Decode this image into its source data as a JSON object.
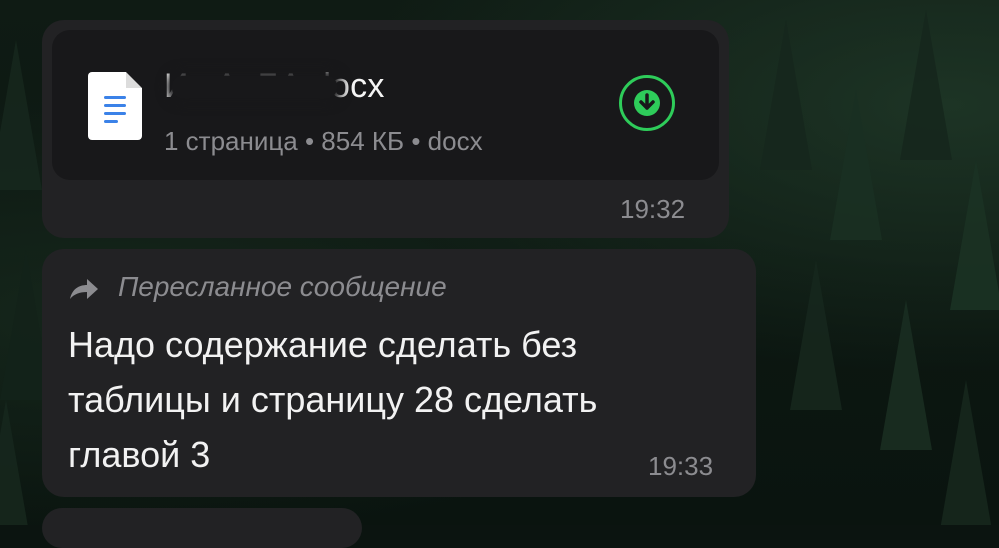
{
  "messages": [
    {
      "type": "file",
      "file_icon": "document-icon",
      "file_name": "Ис                А.  БА.docx",
      "meta": "1 страница • 854 КБ • docx",
      "download_icon": "download-arrow-icon",
      "accent": "#2ecc5a",
      "time": "19:32"
    },
    {
      "type": "forwarded",
      "forward_icon": "forward-arrow-icon",
      "forward_label": "Пересланное сообщение",
      "lines": [
        "Надо содержание сделать без",
        "таблицы и страницу 28 сделать",
        "главой 3"
      ],
      "time": "19:33"
    }
  ],
  "colors": {
    "bubble": "#222224",
    "file_card": "#18181a",
    "text": "#f2f2f2",
    "secondary_text": "#8c8c90"
  }
}
